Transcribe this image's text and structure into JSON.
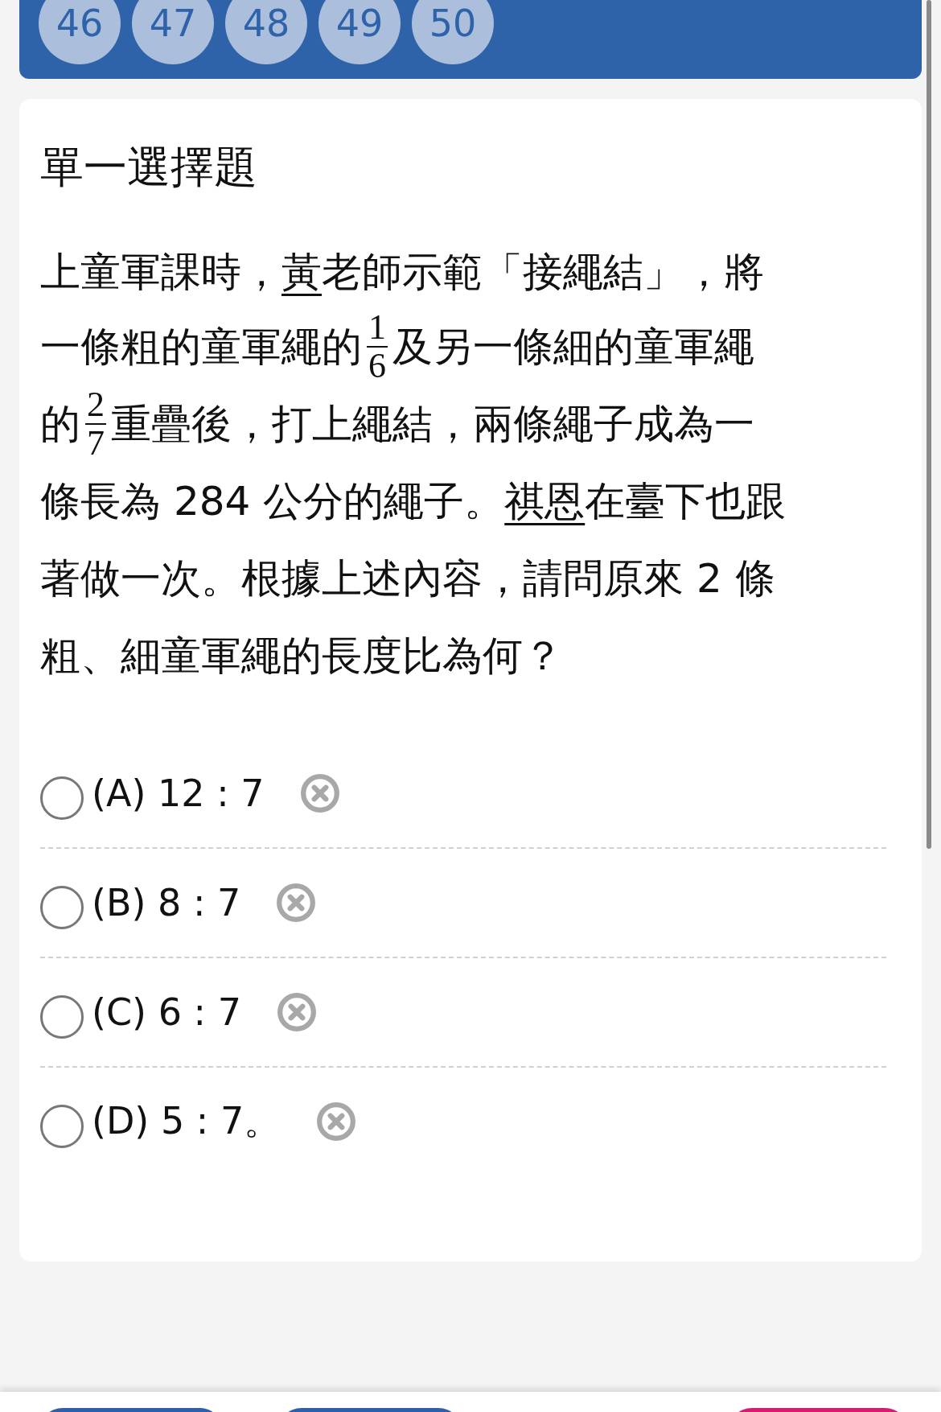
{
  "question_nav": [
    {
      "label": "46",
      "selected": false
    },
    {
      "label": "47",
      "selected": false
    },
    {
      "label": "48",
      "selected": false
    },
    {
      "label": "49",
      "selected": false
    },
    {
      "label": "50",
      "selected": false
    }
  ],
  "question": {
    "type_title": "單一選擇題",
    "lines": [
      [
        {
          "kind": "text",
          "text": "上童軍課時，"
        },
        {
          "kind": "underline",
          "text": "黃"
        },
        {
          "kind": "text",
          "text": "老師示範「接繩結」，將"
        }
      ],
      [
        {
          "kind": "text",
          "text": "一條粗的童軍繩的"
        },
        {
          "kind": "fraction",
          "numerator": "1",
          "denominator": "6"
        },
        {
          "kind": "text",
          "text": "及另一條細的童軍繩"
        }
      ],
      [
        {
          "kind": "text",
          "text": "的"
        },
        {
          "kind": "fraction",
          "numerator": "2",
          "denominator": "7"
        },
        {
          "kind": "text",
          "text": "重疊後，打上繩結，兩條繩子成為一"
        }
      ],
      [
        {
          "kind": "text",
          "text": "條長為 284 公分的繩子。"
        },
        {
          "kind": "underline",
          "text": "祺恩"
        },
        {
          "kind": "text",
          "text": "在臺下也跟"
        }
      ],
      [
        {
          "kind": "text",
          "text": "著做一次。根據上述內容，請問原來 2 條"
        }
      ],
      [
        {
          "kind": "text",
          "text": "粗、細童軍繩的長度比為何？"
        }
      ]
    ]
  },
  "options": [
    {
      "label": "(A) 12 : 7",
      "selected": false
    },
    {
      "label": "(B) 8 : 7",
      "selected": false
    },
    {
      "label": "(C) 6 : 7",
      "selected": false
    },
    {
      "label": "(D) 5 : 7。",
      "selected": false
    }
  ],
  "bottom_buttons": [
    {
      "color": "#2f5fa8"
    },
    {
      "color": "#2f5fa8"
    },
    {
      "color": "#d81b72"
    }
  ]
}
